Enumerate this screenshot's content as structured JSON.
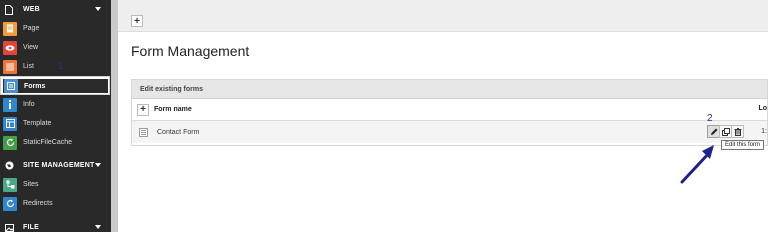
{
  "sidebar": {
    "groups": [
      {
        "label": "WEB",
        "icon": "file-icon"
      },
      {
        "label": "SITE MANAGEMENT",
        "icon": "globe-icon"
      },
      {
        "label": "FILE",
        "icon": "image-icon"
      }
    ],
    "items": [
      {
        "label": "Page",
        "icon": "page-icon",
        "color": "#f49a3b"
      },
      {
        "label": "View",
        "icon": "eye-icon",
        "color": "#e0453a"
      },
      {
        "label": "List",
        "icon": "list-icon",
        "color": "#e8763a"
      },
      {
        "label": "Forms",
        "icon": "forms-icon",
        "color": "#4a8fd0"
      },
      {
        "label": "Info",
        "icon": "info-icon",
        "color": "#2f87d0"
      },
      {
        "label": "Template",
        "icon": "template-icon",
        "color": "#2f87d0"
      },
      {
        "label": "StaticFileCache",
        "icon": "refresh-icon",
        "color": "#43a047"
      },
      {
        "label": "Sites",
        "icon": "sites-icon",
        "color": "#49a889"
      },
      {
        "label": "Redirects",
        "icon": "redirect-icon",
        "color": "#2f87d0"
      }
    ],
    "marker": "1"
  },
  "docheader": {
    "new_label": "+"
  },
  "main": {
    "title": "Form Management",
    "panel_title": "Edit existing forms",
    "add_label": "+",
    "columns": {
      "name": "Form name",
      "location": "Lo"
    },
    "rows": [
      {
        "name": "Contact Form",
        "location": "1:"
      }
    ],
    "tooltip": "Edit this form",
    "marker": "2"
  },
  "colors": {
    "sidebar_bg": "#292929",
    "annotation": "#1f1f8f"
  }
}
